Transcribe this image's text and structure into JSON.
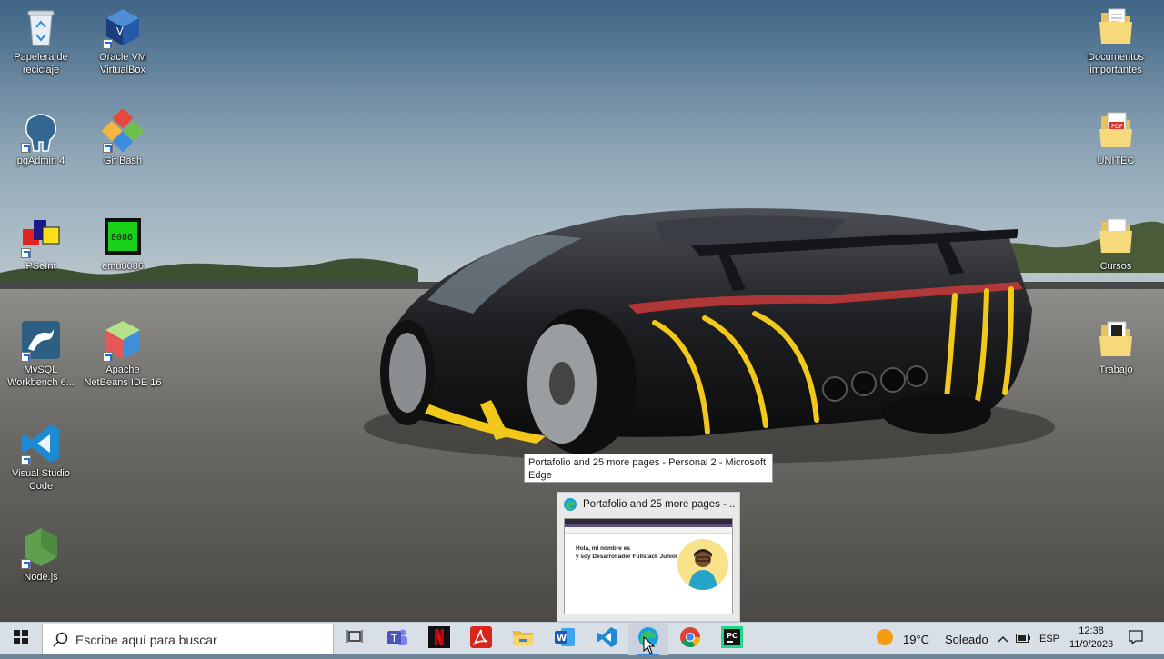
{
  "desktop": {
    "icons_left": [
      {
        "label": "Papelera de reciclaje",
        "icon": "recycle-bin-icon"
      },
      {
        "label": "Oracle VM VirtualBox",
        "icon": "virtualbox-icon"
      },
      {
        "label": "pgAdmin 4",
        "icon": "pgadmin-elephant-icon"
      },
      {
        "label": "Git Bash",
        "icon": "git-bash-icon"
      },
      {
        "label": "PSeInt",
        "icon": "pseint-icon"
      },
      {
        "label": "emu8086",
        "icon": "emu8086-chip-icon",
        "chip_text": "8086"
      },
      {
        "label": "MySQL Workbench 6...",
        "icon": "mysql-workbench-icon"
      },
      {
        "label": "Apache NetBeans IDE 16",
        "icon": "netbeans-cube-icon"
      },
      {
        "label": "Visual Studio Code",
        "icon": "vscode-icon"
      },
      {
        "label": "Node.js",
        "icon": "nodejs-hexagon-icon"
      }
    ],
    "icons_right": [
      {
        "label": "Documentos importantes",
        "icon": "folder-document-icon"
      },
      {
        "label": "UNITEC",
        "icon": "pdf-folder-icon",
        "badge": "PDF"
      },
      {
        "label": "Cursos",
        "icon": "folder-icon"
      },
      {
        "label": "Trabajo",
        "icon": "folder-trabajo-icon"
      }
    ]
  },
  "tooltip": {
    "text": "Portafolio and 25 more pages - Personal 2 - Microsoft Edge"
  },
  "preview": {
    "title": "Portafolio and 25 more pages - ...",
    "close": "✕",
    "thumb_line1": "Hola, mi nombre es",
    "thumb_line2": "y soy Desarrollador Fullstack Junior"
  },
  "taskbar": {
    "search_placeholder": "Escribe aquí para buscar",
    "apps": [
      {
        "name": "task-view",
        "icon": "task-view-icon"
      },
      {
        "name": "teams",
        "icon": "teams-icon"
      },
      {
        "name": "netflix",
        "icon": "netflix-icon"
      },
      {
        "name": "acrobat",
        "icon": "acrobat-icon"
      },
      {
        "name": "file-explorer",
        "icon": "file-explorer-icon"
      },
      {
        "name": "word",
        "icon": "word-icon"
      },
      {
        "name": "vscode",
        "icon": "vscode-icon"
      },
      {
        "name": "edge",
        "icon": "edge-icon",
        "active": true
      },
      {
        "name": "chrome",
        "icon": "chrome-icon"
      },
      {
        "name": "pycharm",
        "icon": "pycharm-icon"
      }
    ],
    "weather": {
      "temp": "19°C",
      "condition": "Soleado"
    },
    "language": "ESP",
    "time": "12:38",
    "date": "11/9/2023"
  },
  "colors": {
    "taskbar_bg": "#d9dfe7",
    "accent": "#3b82d6",
    "car_body": "#1b1c1e",
    "car_accent": "#f2c81b"
  }
}
